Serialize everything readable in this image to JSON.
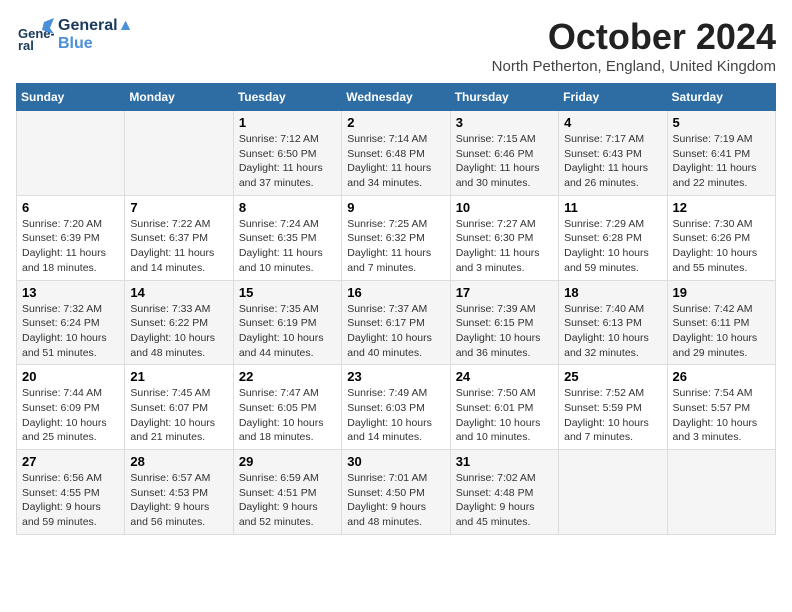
{
  "logo": {
    "line1": "General",
    "line2": "Blue"
  },
  "title": "October 2024",
  "location": "North Petherton, England, United Kingdom",
  "headers": [
    "Sunday",
    "Monday",
    "Tuesday",
    "Wednesday",
    "Thursday",
    "Friday",
    "Saturday"
  ],
  "rows": [
    [
      {
        "day": "",
        "text": ""
      },
      {
        "day": "",
        "text": ""
      },
      {
        "day": "1",
        "text": "Sunrise: 7:12 AM\nSunset: 6:50 PM\nDaylight: 11 hours and 37 minutes."
      },
      {
        "day": "2",
        "text": "Sunrise: 7:14 AM\nSunset: 6:48 PM\nDaylight: 11 hours and 34 minutes."
      },
      {
        "day": "3",
        "text": "Sunrise: 7:15 AM\nSunset: 6:46 PM\nDaylight: 11 hours and 30 minutes."
      },
      {
        "day": "4",
        "text": "Sunrise: 7:17 AM\nSunset: 6:43 PM\nDaylight: 11 hours and 26 minutes."
      },
      {
        "day": "5",
        "text": "Sunrise: 7:19 AM\nSunset: 6:41 PM\nDaylight: 11 hours and 22 minutes."
      }
    ],
    [
      {
        "day": "6",
        "text": "Sunrise: 7:20 AM\nSunset: 6:39 PM\nDaylight: 11 hours and 18 minutes."
      },
      {
        "day": "7",
        "text": "Sunrise: 7:22 AM\nSunset: 6:37 PM\nDaylight: 11 hours and 14 minutes."
      },
      {
        "day": "8",
        "text": "Sunrise: 7:24 AM\nSunset: 6:35 PM\nDaylight: 11 hours and 10 minutes."
      },
      {
        "day": "9",
        "text": "Sunrise: 7:25 AM\nSunset: 6:32 PM\nDaylight: 11 hours and 7 minutes."
      },
      {
        "day": "10",
        "text": "Sunrise: 7:27 AM\nSunset: 6:30 PM\nDaylight: 11 hours and 3 minutes."
      },
      {
        "day": "11",
        "text": "Sunrise: 7:29 AM\nSunset: 6:28 PM\nDaylight: 10 hours and 59 minutes."
      },
      {
        "day": "12",
        "text": "Sunrise: 7:30 AM\nSunset: 6:26 PM\nDaylight: 10 hours and 55 minutes."
      }
    ],
    [
      {
        "day": "13",
        "text": "Sunrise: 7:32 AM\nSunset: 6:24 PM\nDaylight: 10 hours and 51 minutes."
      },
      {
        "day": "14",
        "text": "Sunrise: 7:33 AM\nSunset: 6:22 PM\nDaylight: 10 hours and 48 minutes."
      },
      {
        "day": "15",
        "text": "Sunrise: 7:35 AM\nSunset: 6:19 PM\nDaylight: 10 hours and 44 minutes."
      },
      {
        "day": "16",
        "text": "Sunrise: 7:37 AM\nSunset: 6:17 PM\nDaylight: 10 hours and 40 minutes."
      },
      {
        "day": "17",
        "text": "Sunrise: 7:39 AM\nSunset: 6:15 PM\nDaylight: 10 hours and 36 minutes."
      },
      {
        "day": "18",
        "text": "Sunrise: 7:40 AM\nSunset: 6:13 PM\nDaylight: 10 hours and 32 minutes."
      },
      {
        "day": "19",
        "text": "Sunrise: 7:42 AM\nSunset: 6:11 PM\nDaylight: 10 hours and 29 minutes."
      }
    ],
    [
      {
        "day": "20",
        "text": "Sunrise: 7:44 AM\nSunset: 6:09 PM\nDaylight: 10 hours and 25 minutes."
      },
      {
        "day": "21",
        "text": "Sunrise: 7:45 AM\nSunset: 6:07 PM\nDaylight: 10 hours and 21 minutes."
      },
      {
        "day": "22",
        "text": "Sunrise: 7:47 AM\nSunset: 6:05 PM\nDaylight: 10 hours and 18 minutes."
      },
      {
        "day": "23",
        "text": "Sunrise: 7:49 AM\nSunset: 6:03 PM\nDaylight: 10 hours and 14 minutes."
      },
      {
        "day": "24",
        "text": "Sunrise: 7:50 AM\nSunset: 6:01 PM\nDaylight: 10 hours and 10 minutes."
      },
      {
        "day": "25",
        "text": "Sunrise: 7:52 AM\nSunset: 5:59 PM\nDaylight: 10 hours and 7 minutes."
      },
      {
        "day": "26",
        "text": "Sunrise: 7:54 AM\nSunset: 5:57 PM\nDaylight: 10 hours and 3 minutes."
      }
    ],
    [
      {
        "day": "27",
        "text": "Sunrise: 6:56 AM\nSunset: 4:55 PM\nDaylight: 9 hours and 59 minutes."
      },
      {
        "day": "28",
        "text": "Sunrise: 6:57 AM\nSunset: 4:53 PM\nDaylight: 9 hours and 56 minutes."
      },
      {
        "day": "29",
        "text": "Sunrise: 6:59 AM\nSunset: 4:51 PM\nDaylight: 9 hours and 52 minutes."
      },
      {
        "day": "30",
        "text": "Sunrise: 7:01 AM\nSunset: 4:50 PM\nDaylight: 9 hours and 48 minutes."
      },
      {
        "day": "31",
        "text": "Sunrise: 7:02 AM\nSunset: 4:48 PM\nDaylight: 9 hours and 45 minutes."
      },
      {
        "day": "",
        "text": ""
      },
      {
        "day": "",
        "text": ""
      }
    ]
  ]
}
